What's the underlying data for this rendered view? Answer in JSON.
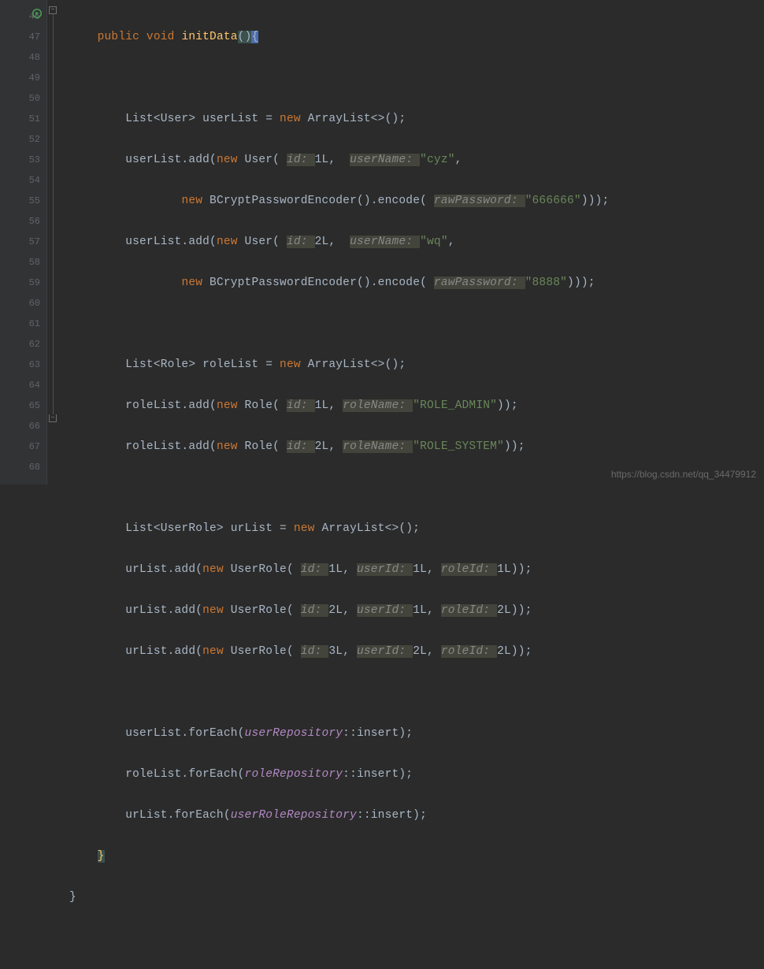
{
  "lines": [
    46,
    47,
    48,
    49,
    50,
    51,
    52,
    53,
    54,
    55,
    56,
    57,
    58,
    59,
    60,
    61,
    62,
    63,
    64,
    65,
    66,
    67,
    68
  ],
  "code": {
    "l46_public": "public ",
    "l46_void": "void ",
    "l46_method": "initData",
    "l46_paren_open": "(",
    "l46_paren_close": ")",
    "l46_brace": "{",
    "l48": "        List<User> userList = ",
    "l48_new": "new ",
    "l48_rest": "ArrayList<>();",
    "l49": "        userList.add(",
    "l49_new": "new ",
    "l49_user": "User( ",
    "l49_p1": "id: ",
    "l49_v1": "1L",
    "l49_c1": ",  ",
    "l49_p2": "userName: ",
    "l49_v2": "\"cyz\"",
    "l49_end": ",",
    "l50": "                ",
    "l50_new": "new ",
    "l50_enc": "BCryptPasswordEncoder().encode( ",
    "l50_p": "rawPassword: ",
    "l50_v": "\"666666\"",
    "l50_end": ")));",
    "l51": "        userList.add(",
    "l51_new": "new ",
    "l51_user": "User( ",
    "l51_p1": "id: ",
    "l51_v1": "2L",
    "l51_c1": ",  ",
    "l51_p2": "userName: ",
    "l51_v2": "\"wq\"",
    "l51_end": ",",
    "l52": "                ",
    "l52_new": "new ",
    "l52_enc": "BCryptPasswordEncoder().encode( ",
    "l52_p": "rawPassword: ",
    "l52_v": "\"8888\"",
    "l52_end": ")));",
    "l54": "        List<Role> roleList = ",
    "l54_new": "new ",
    "l54_rest": "ArrayList<>();",
    "l55": "        roleList.add(",
    "l55_new": "new ",
    "l55_role": "Role( ",
    "l55_p1": "id: ",
    "l55_v1": "1L",
    "l55_c1": ", ",
    "l55_p2": "roleName: ",
    "l55_v2": "\"ROLE_ADMIN\"",
    "l55_end": "));",
    "l56": "        roleList.add(",
    "l56_new": "new ",
    "l56_role": "Role( ",
    "l56_p1": "id: ",
    "l56_v1": "2L",
    "l56_c1": ", ",
    "l56_p2": "roleName: ",
    "l56_v2": "\"ROLE_SYSTEM\"",
    "l56_end": "));",
    "l58": "        List<UserRole> urList = ",
    "l58_new": "new ",
    "l58_rest": "ArrayList<>();",
    "l59": "        urList.add(",
    "l59_new": "new ",
    "l59_ur": "UserRole( ",
    "l59_p1": "id: ",
    "l59_v1": "1L",
    "l59_c1": ", ",
    "l59_p2": "userId: ",
    "l59_v2": "1L",
    "l59_c2": ", ",
    "l59_p3": "roleId: ",
    "l59_v3": "1L",
    "l59_end": "));",
    "l60": "        urList.add(",
    "l60_new": "new ",
    "l60_ur": "UserRole( ",
    "l60_p1": "id: ",
    "l60_v1": "2L",
    "l60_c1": ", ",
    "l60_p2": "userId: ",
    "l60_v2": "1L",
    "l60_c2": ", ",
    "l60_p3": "roleId: ",
    "l60_v3": "2L",
    "l60_end": "));",
    "l61": "        urList.add(",
    "l61_new": "new ",
    "l61_ur": "UserRole( ",
    "l61_p1": "id: ",
    "l61_v1": "3L",
    "l61_c1": ", ",
    "l61_p2": "userId: ",
    "l61_v2": "2L",
    "l61_c2": ", ",
    "l61_p3": "roleId: ",
    "l61_v3": "2L",
    "l61_end": "));",
    "l63": "        userList.forEach(",
    "l63_lam": "userRepository",
    "l63_end": "::insert);",
    "l64": "        roleList.forEach(",
    "l64_lam": "roleRepository",
    "l64_end": "::insert);",
    "l65": "        urList.forEach(",
    "l65_lam": "userRoleRepository",
    "l65_end": "::insert);",
    "l66": "    ",
    "l66_brace": "}",
    "l67": "}"
  },
  "watermark": "https://blog.csdn.net/qq_34479912"
}
